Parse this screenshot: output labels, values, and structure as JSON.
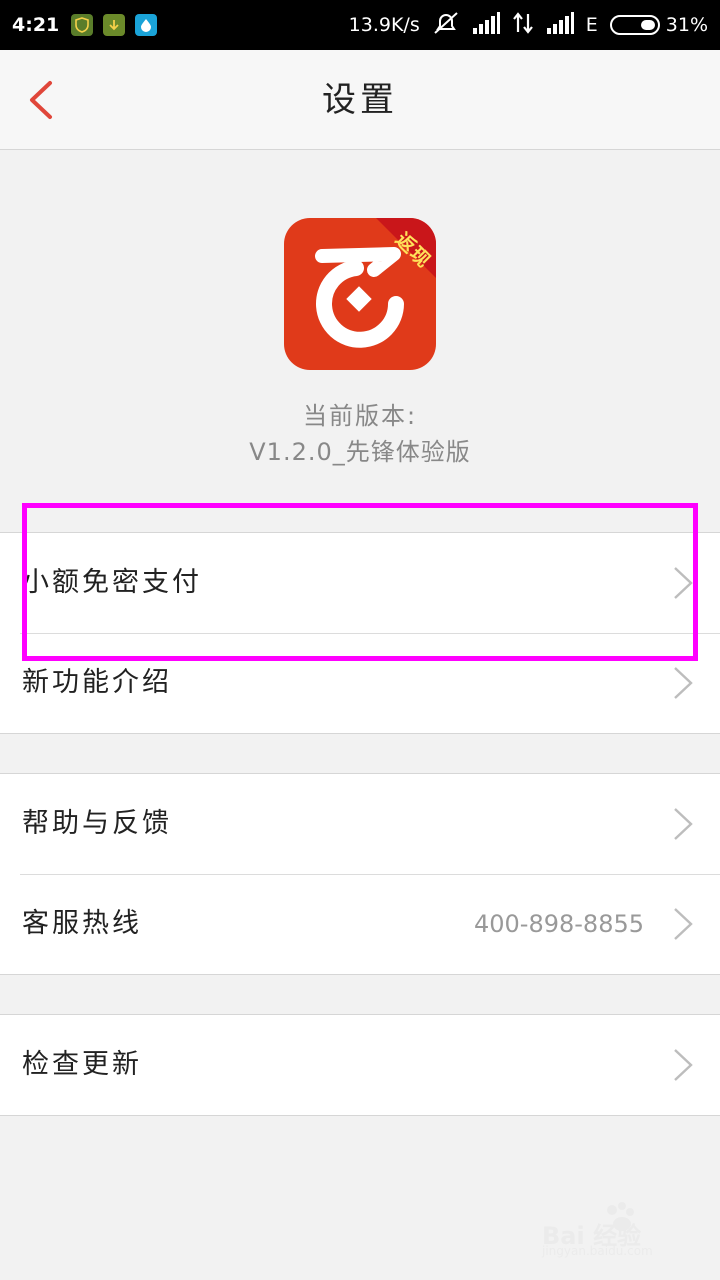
{
  "status_bar": {
    "time": "4:21",
    "speed": "13.9K/s",
    "network_type": "E",
    "battery": "31%",
    "icons": [
      "shield-icon",
      "download-icon",
      "droplet-icon",
      "mute-icon",
      "signal-icon",
      "data-arrows-icon",
      "signal-icon"
    ]
  },
  "header": {
    "title": "设置",
    "back_icon": "chevron-left-icon"
  },
  "app": {
    "badge": "返现",
    "version_label": "当前版本:",
    "version_value": "V1.2.0_先锋体验版"
  },
  "settings": {
    "group1": [
      {
        "label": "小额免密支付"
      },
      {
        "label": "新功能介绍"
      }
    ],
    "group2": [
      {
        "label": "帮助与反馈"
      },
      {
        "label": "客服热线",
        "value": "400-898-8855"
      }
    ],
    "group3": [
      {
        "label": "检查更新"
      }
    ]
  },
  "colors": {
    "accent": "#e03a1a",
    "back_arrow": "#e0463a",
    "highlight": "#ff00ff"
  },
  "watermark": {
    "text": "Bai 经验",
    "url_text": "jingyan.baidu.com"
  }
}
